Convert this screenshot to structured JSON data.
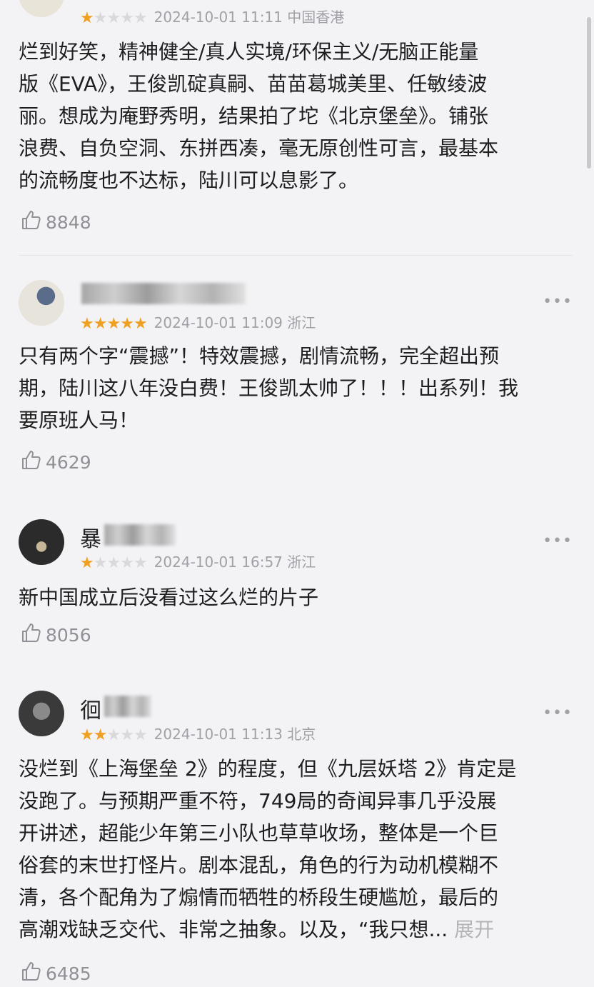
{
  "reviews": [
    {
      "rating": 1,
      "date": "2024-10-01 11:11",
      "location": "中国香港",
      "text": "烂到好笑，精神健全/真人实境/环保主义/无脑正能量\n版《EVA》，王俊凯碇真嗣、苗苗葛城美里、任敏绫波\n丽。想成为庵野秀明，结果拍了坨《北京堡垒》。铺张\n浪费、自负空洞、东拼西凑，毫无原创性可言，最基本\n的流畅度也不达标，陆川可以息影了。",
      "likes": "8848"
    },
    {
      "name_initial": "another",
      "rating": 5,
      "date": "2024-10-01 11:09",
      "location": "浙江",
      "text": "只有两个字“震撼”！特效震撼，剧情流畅，完全超出预\n期，陆川这八年没白费！王俊凯太帅了！！！出系列！我\n要原班人马！",
      "likes": "4629"
    },
    {
      "name_initial": "暴",
      "rating": 1,
      "date": "2024-10-01 16:57",
      "location": "浙江",
      "text": "新中国成立后没看过这么烂的片子",
      "likes": "8056"
    },
    {
      "name_initial": "徊",
      "rating": 2,
      "date": "2024-10-01 11:13",
      "location": "北京",
      "text": "没烂到《上海堡垒 2》的程度，但《九层妖塔 2》肯定是\n没跑了。与预期严重不符，749局的奇闻异事几乎没展\n开讲述，超能少年第三小队也草草收场，整体是一个巨\n俗套的末世打怪片。剧本混乱，角色的行为动机模糊不\n清，各个配角为了煽情而牺牲的桥段生硬尴尬，最后的\n高潮戏缺乏交代、非常之抽象。以及，“我只想... ",
      "expand": "展开",
      "likes": "6485"
    }
  ],
  "more_label": "•••",
  "colors": {
    "star_on": "#f0a020",
    "star_off": "#d9d9dc",
    "meta": "#a0a0a6"
  }
}
